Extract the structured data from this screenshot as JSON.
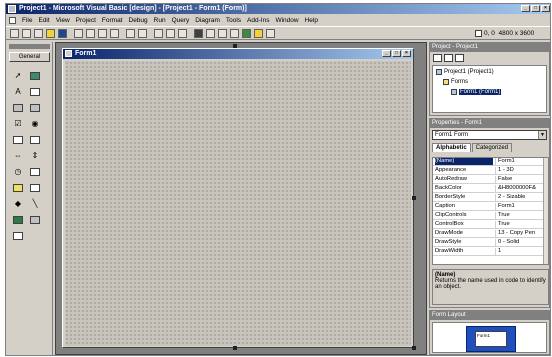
{
  "window": {
    "title": "Project1 - Microsoft Visual Basic [design] - [Project1 - Form1 (Form)]",
    "controls": [
      "_",
      "□",
      "×"
    ]
  },
  "menu": {
    "items": [
      "File",
      "Edit",
      "View",
      "Project",
      "Format",
      "Debug",
      "Run",
      "Query",
      "Diagram",
      "Tools",
      "Add-Ins",
      "Window",
      "Help"
    ]
  },
  "toolbar": {
    "coords": "0, 0",
    "size": "4800 x 3600"
  },
  "toolbox": {
    "tab_label": "General"
  },
  "form": {
    "title": "Form1",
    "controls": [
      "_",
      "□",
      "×"
    ]
  },
  "project_explorer": {
    "title": "Project - Project1",
    "root": "Project1 (Project1)",
    "folder": "Forms",
    "item": "Form1 (Form1)"
  },
  "properties": {
    "title": "Properties - Form1",
    "object": "Form1 Form",
    "tabs": [
      "Alphabetic",
      "Categorized"
    ],
    "rows": [
      {
        "name": "(Name)",
        "value": "Form1"
      },
      {
        "name": "Appearance",
        "value": "1 - 3D"
      },
      {
        "name": "AutoRedraw",
        "value": "False"
      },
      {
        "name": "BackColor",
        "value": "&H8000000F&"
      },
      {
        "name": "BorderStyle",
        "value": "2 - Sizable"
      },
      {
        "name": "Caption",
        "value": "Form1"
      },
      {
        "name": "ClipControls",
        "value": "True"
      },
      {
        "name": "ControlBox",
        "value": "True"
      },
      {
        "name": "DrawMode",
        "value": "13 - Copy Pen"
      },
      {
        "name": "DrawStyle",
        "value": "0 - Solid"
      },
      {
        "name": "DrawWidth",
        "value": "1"
      }
    ],
    "desc_name": "(Name)",
    "desc_text": "Returns the name used in code to identify an object."
  },
  "form_layout": {
    "title": "Form Layout",
    "mini_label": "Form1"
  }
}
